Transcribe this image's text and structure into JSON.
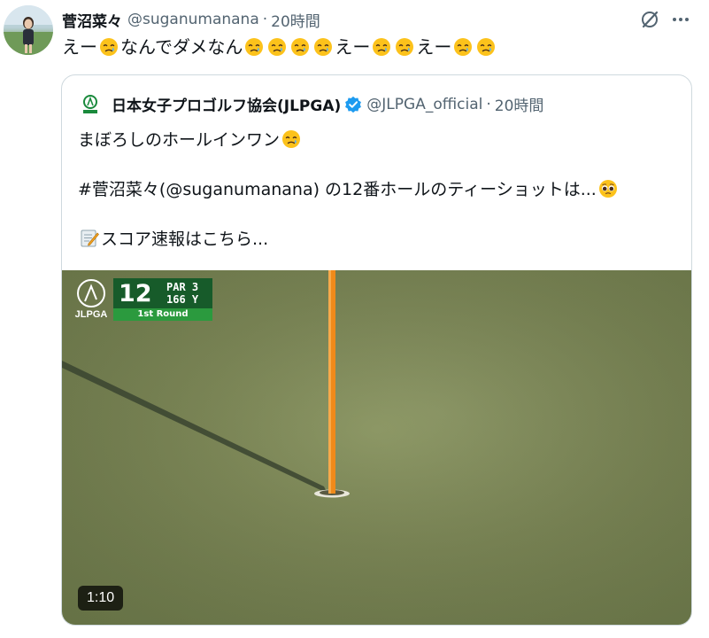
{
  "post": {
    "author_name": "菅沼菜々",
    "author_handle": "@suganumanana",
    "separator": "·",
    "time": "20時間",
    "text_parts": [
      "えー",
      "なんでダメなん",
      "えー",
      "えー"
    ],
    "emoji": "face-holding-back-tears",
    "icons": {
      "grok": "grok-icon",
      "more": "more-icon",
      "avatar": "avatar"
    }
  },
  "quote": {
    "author_name": "日本女子プロゴルフ協会(JLPGA)",
    "author_handle": "@JLPGA_official",
    "separator": "·",
    "time": "20時間",
    "verified_color": "#1d9bf0",
    "line1": "まぼろしのホールインワン",
    "line2_hashtag": "#菅沼菜々",
    "line2_rest": "(@suganumanana) の12番ホールのティーショットは...",
    "line3": "スコア速報はこちら...",
    "line2_emoji": "pleading-face",
    "line3_emoji": "memo"
  },
  "media": {
    "logo_text": "JLPGA",
    "hole_number": "12",
    "par_text": "PAR 3",
    "yardage_text": "166 Y",
    "round_text": "1st Round",
    "duration": "1:10",
    "colors": {
      "green": "#85905d",
      "flag": "#f08a1a",
      "scoreboard": "#175b2a",
      "round_bar": "#2b9a3e"
    }
  }
}
